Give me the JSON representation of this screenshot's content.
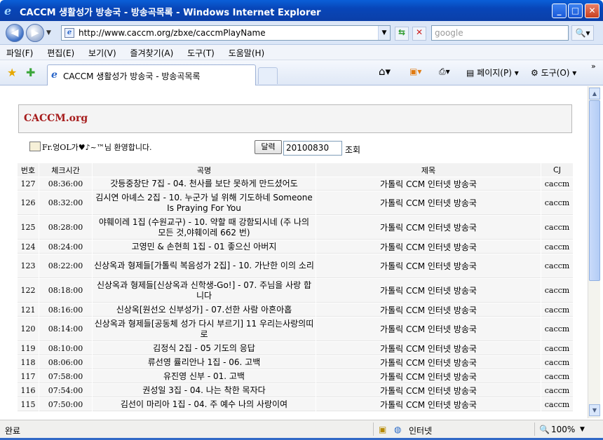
{
  "window": {
    "title": "CACCM 생활성가 방송국 - 방송곡목록 - Windows Internet Explorer",
    "btn_min": "_",
    "btn_max": "□",
    "btn_close": "✕"
  },
  "address": {
    "url": "http://www.caccm.org/zbxe/caccmPlayName",
    "search_placeholder": "google"
  },
  "menu": [
    "파일(F)",
    "편집(E)",
    "보기(V)",
    "즐겨찾기(A)",
    "도구(T)",
    "도움말(H)"
  ],
  "tab": {
    "label": "CACCM 생활성가 방송국 - 방송곡목록"
  },
  "toolbar": {
    "page_label": "페이지(P)",
    "tools_label": "도구(O)"
  },
  "page": {
    "brand": "CACCM.org",
    "welcome": "Fr.엉OL가♥♪~™님 환영합니다.",
    "calendar_button": "달력",
    "date_value": "20100830",
    "view_label": "조회",
    "columns": [
      "번호",
      "체크시간",
      "곡명",
      "제목",
      "CJ"
    ],
    "rows": [
      {
        "no": "127",
        "time": "08:36:00",
        "title": "갓등중창단 7집 - 04. 천사를 보단 못하게 만드셨어도",
        "program": "가톨릭 CCM 인터넷 방송국",
        "cj": "caccm"
      },
      {
        "no": "126",
        "time": "08:32:00",
        "title": "김시연 아녜스 2집 - 10. 누군가 널 위해 기도하네 Someone Is Praying For You",
        "program": "가톨릭 CCM 인터넷 방송국",
        "cj": "caccm"
      },
      {
        "no": "125",
        "time": "08:28:00",
        "title": "야훼이레 1집 (수원교구) - 10. 약할 때 강함되시네 (주 나의 모든 것,야훼이레 662 번)",
        "program": "가톨릭 CCM 인터넷 방송국",
        "cj": "caccm"
      },
      {
        "no": "124",
        "time": "08:24:00",
        "title": "고영민 & 손현희 1집 - 01 좋으신 아버지",
        "program": "가톨릭 CCM 인터넷 방송국",
        "cj": "caccm"
      },
      {
        "no": "123",
        "time": "08:22:00",
        "title": "신상옥과 형제들[가톨릭 복음성가 2집] - 10. 가난한 이의 소리",
        "program": "가톨릭 CCM 인터넷 방송국",
        "cj": "caccm"
      },
      {
        "no": "122",
        "time": "08:18:00",
        "title": "신상옥과 형제들[신상옥과 신학생-Go!] - 07. 주님을 사랑 합니다",
        "program": "가톨릭 CCM 인터넷 방송국",
        "cj": "caccm"
      },
      {
        "no": "121",
        "time": "08:16:00",
        "title": "신상옥[원선오 신부성가] - 07.선한 사람 아흔아홉",
        "program": "가톨릭 CCM 인터넷 방송국",
        "cj": "caccm"
      },
      {
        "no": "120",
        "time": "08:14:00",
        "title": "신상옥과 형제들[공동체 성가 다시 부르기] 11 우리는사랑의띠로",
        "program": "가톨릭 CCM 인터넷 방송국",
        "cj": "caccm"
      },
      {
        "no": "119",
        "time": "08:10:00",
        "title": "김정식 2집 - 05 기도의 응답",
        "program": "가톨릭 CCM 인터넷 방송국",
        "cj": "caccm"
      },
      {
        "no": "118",
        "time": "08:06:00",
        "title": "류선영 률리안나 1집 - 06. 고백",
        "program": "가톨릭 CCM 인터넷 방송국",
        "cj": "caccm"
      },
      {
        "no": "117",
        "time": "07:58:00",
        "title": "유진영 신부 - 01. 고백",
        "program": "가톨릭 CCM 인터넷 방송국",
        "cj": "caccm"
      },
      {
        "no": "116",
        "time": "07:54:00",
        "title": "권성일 3집 - 04. 나는 착한 목자다",
        "program": "가톨릭 CCM 인터넷 방송국",
        "cj": "caccm"
      },
      {
        "no": "115",
        "time": "07:50:00",
        "title": "김선이 마리아 1집 - 04. 주 예수 나의 사랑이여",
        "program": "가톨릭 CCM 인터넷 방송국",
        "cj": "caccm"
      }
    ]
  },
  "status": {
    "done": "완료",
    "zone": "인터넷",
    "zoom": "100%"
  }
}
